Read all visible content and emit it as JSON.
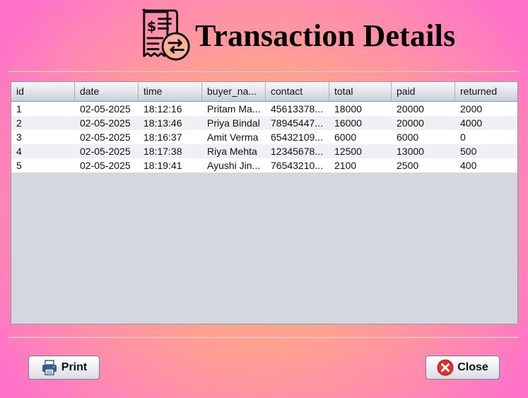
{
  "header": {
    "title": "Transaction Details",
    "icon": "receipt-transfer-icon"
  },
  "table": {
    "columns": [
      "id",
      "date",
      "time",
      "buyer_na...",
      "contact",
      "total",
      "paid",
      "returned"
    ],
    "rows": [
      [
        "1",
        "02-05-2025",
        "18:12:16",
        "Pritam Ma...",
        "45613378...",
        "18000",
        "20000",
        "2000"
      ],
      [
        "2",
        "02-05-2025",
        "18:13:46",
        "Priya Bindal",
        "78945447...",
        "16000",
        "20000",
        "4000"
      ],
      [
        "3",
        "02-05-2025",
        "18:16:37",
        "Amit Verma",
        "65432109...",
        "6000",
        "6000",
        "0"
      ],
      [
        "4",
        "02-05-2025",
        "18:17:38",
        "Riya Mehta",
        "12345678...",
        "12500",
        "13000",
        "500"
      ],
      [
        "5",
        "02-05-2025",
        "18:19:41",
        "Ayushi Jin...",
        "76543210...",
        "2100",
        "2500",
        "400"
      ]
    ]
  },
  "buttons": {
    "print_label": "Print",
    "print_icon": "printer-icon",
    "close_label": "Close",
    "close_icon": "close-circle-icon"
  },
  "colors": {
    "close_icon": "#e03131",
    "print_icon": "#3b5b8c"
  }
}
